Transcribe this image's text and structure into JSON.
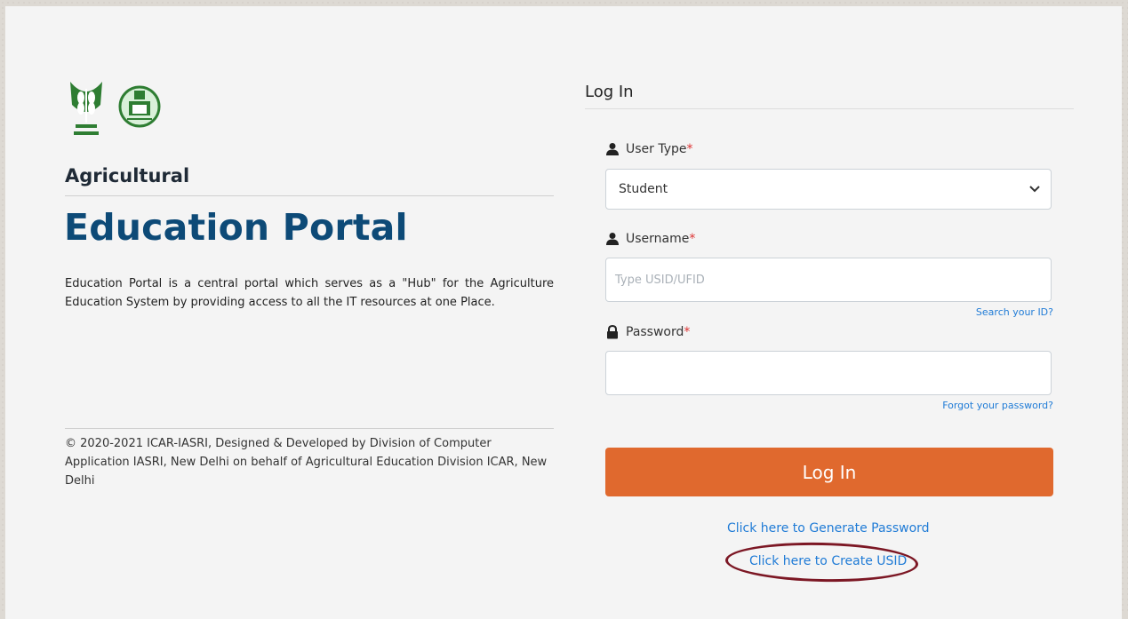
{
  "branding": {
    "heading_small": "Agricultural",
    "heading_big": "Education Portal",
    "intro": "Education Portal is a central portal which serves as a \"Hub\" for the Agriculture Education System by providing access to all the IT resources at one Place.",
    "copyright": "© 2020-2021 ICAR-IASRI, Designed & Developed by Division of Computer Application IASRI, New Delhi on behalf of Agricultural Education Division ICAR, New Delhi",
    "logos": [
      "icar-logo",
      "iasri-emblem-logo"
    ]
  },
  "login": {
    "title": "Log In",
    "user_type_label": "User Type",
    "user_type_value": "Student",
    "username_label": "Username",
    "username_placeholder": "Type USID/UFID",
    "search_id_link": "Search your ID?",
    "password_label": "Password",
    "password_value": "",
    "forgot_password_link": "Forgot your password?",
    "submit_label": "Log In",
    "generate_password_link": "Click here to Generate Password",
    "create_usid_link": "Click here to Create USID",
    "required_marker": "*"
  },
  "icons": {
    "user": "user-icon",
    "lock": "lock-icon",
    "dropdown": "chevron-down-icon"
  },
  "colors": {
    "accent_button": "#e0692e",
    "heading": "#0d4a77",
    "link": "#1f7bd6",
    "highlight_ellipse": "#7c1724"
  }
}
